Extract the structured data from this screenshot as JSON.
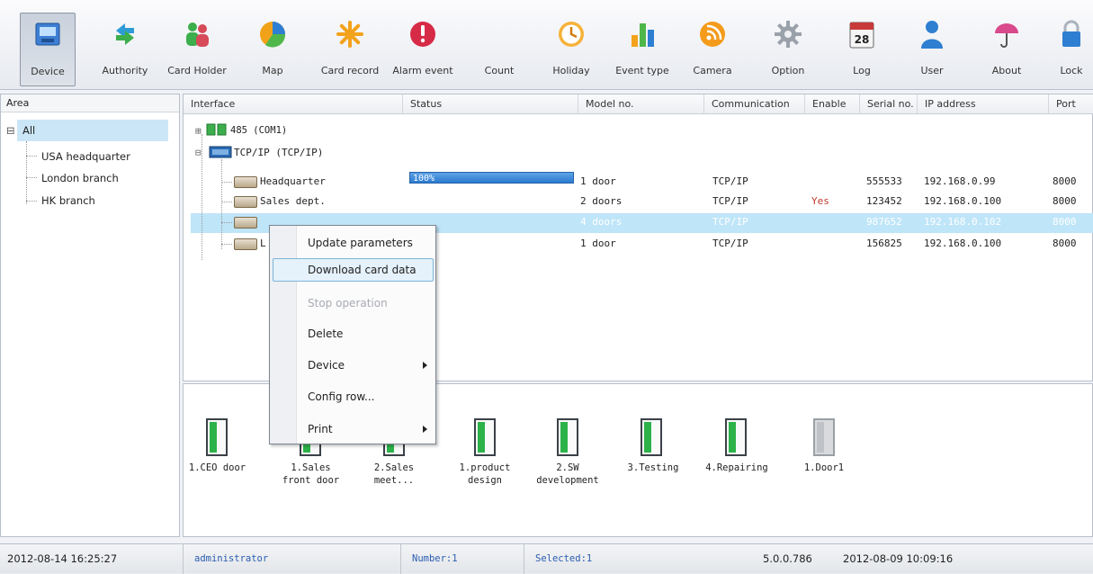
{
  "toolbar": {
    "items": [
      {
        "label": "Device",
        "icon": "device-icon"
      },
      {
        "label": "Authority",
        "icon": "authority-icon"
      },
      {
        "label": "Card Holder",
        "icon": "card-holder-icon"
      },
      {
        "label": "Map",
        "icon": "map-icon"
      },
      {
        "label": "Card record",
        "icon": "card-record-icon"
      },
      {
        "label": "Alarm event",
        "icon": "alarm-icon"
      },
      {
        "label": "Count",
        "icon": "count-icon"
      },
      {
        "label": "Holiday",
        "icon": "clock-icon"
      },
      {
        "label": "Event type",
        "icon": "bar-chart-icon"
      },
      {
        "label": "Camera",
        "icon": "camera-icon"
      },
      {
        "label": "Option",
        "icon": "gear-icon"
      },
      {
        "label": "Log",
        "icon": "calendar-icon",
        "badge": "28"
      },
      {
        "label": "User",
        "icon": "user-icon"
      },
      {
        "label": "About",
        "icon": "umbrella-icon"
      },
      {
        "label": "Lock",
        "icon": "lock-icon"
      }
    ]
  },
  "area": {
    "header": "Area",
    "root": "All",
    "expand": "⊟",
    "children": [
      "USA headquarter",
      "London branch",
      "HK branch"
    ]
  },
  "grid": {
    "columns": [
      "Interface",
      "Status",
      "Model no.",
      "Communication",
      "Enable",
      "Serial no.",
      "IP address",
      "Port"
    ],
    "groups": [
      {
        "label": "485 (COM1)",
        "toggle": "⊞"
      },
      {
        "label": "TCP/IP (TCP/IP)",
        "toggle": "⊟"
      }
    ],
    "rows": [
      {
        "interface": "Headquarter",
        "status": "100%",
        "progress": 1.0,
        "model": "1 door",
        "comm": "TCP/IP",
        "enable": "",
        "serial": "555533",
        "ip": "192.168.0.99",
        "port": "8000"
      },
      {
        "interface": "Sales dept.",
        "status": "",
        "model": "2 doors",
        "comm": "TCP/IP",
        "enable": "Yes",
        "serial": "123452",
        "ip": "192.168.0.100",
        "port": "8000"
      },
      {
        "interface": "",
        "status": "",
        "model": "4 doors",
        "comm": "TCP/IP",
        "enable": "",
        "serial": "987652",
        "ip": "192.168.0.102",
        "port": "8000"
      },
      {
        "interface": "L",
        "status": "",
        "model": "1 door",
        "comm": "TCP/IP",
        "enable": "",
        "serial": "156825",
        "ip": "192.168.0.100",
        "port": "8000"
      }
    ]
  },
  "doors": [
    {
      "l1": "1.CEO door",
      "l2": "",
      "state": "open"
    },
    {
      "l1": "1.Sales",
      "l2": "front door",
      "state": "open"
    },
    {
      "l1": "2.Sales",
      "l2": "meet...",
      "state": "open"
    },
    {
      "l1": "1.product",
      "l2": "design",
      "state": "open"
    },
    {
      "l1": "2.SW",
      "l2": "development",
      "state": "open"
    },
    {
      "l1": "3.Testing",
      "l2": "",
      "state": "open"
    },
    {
      "l1": "4.Repairing",
      "l2": "",
      "state": "open"
    },
    {
      "l1": "1.Door1",
      "l2": "",
      "state": "offline"
    }
  ],
  "context_menu": {
    "items": [
      {
        "label": "Update parameters",
        "disabled": false
      },
      {
        "label": "Download card data",
        "disabled": false,
        "highlighted": true
      },
      {
        "label": "Stop operation",
        "disabled": true
      },
      {
        "label": "Delete",
        "disabled": false
      },
      {
        "label": "Device",
        "disabled": false,
        "submenu": true
      },
      {
        "label": "Config row...",
        "disabled": false
      },
      {
        "label": "Print",
        "disabled": false,
        "submenu": true
      }
    ]
  },
  "status_bar": {
    "datetime": "2012-08-14 16:25:27",
    "user": "administrator",
    "number": "Number:1",
    "selected": "Selected:1",
    "version": "5.0.0.786",
    "build_date": "2012-08-09 10:09:16"
  },
  "colors": {
    "selection": "#bfe5f8",
    "progress": "#2a7ad0",
    "enable_yes": "#c0392b",
    "door_green": "#2db24a"
  }
}
